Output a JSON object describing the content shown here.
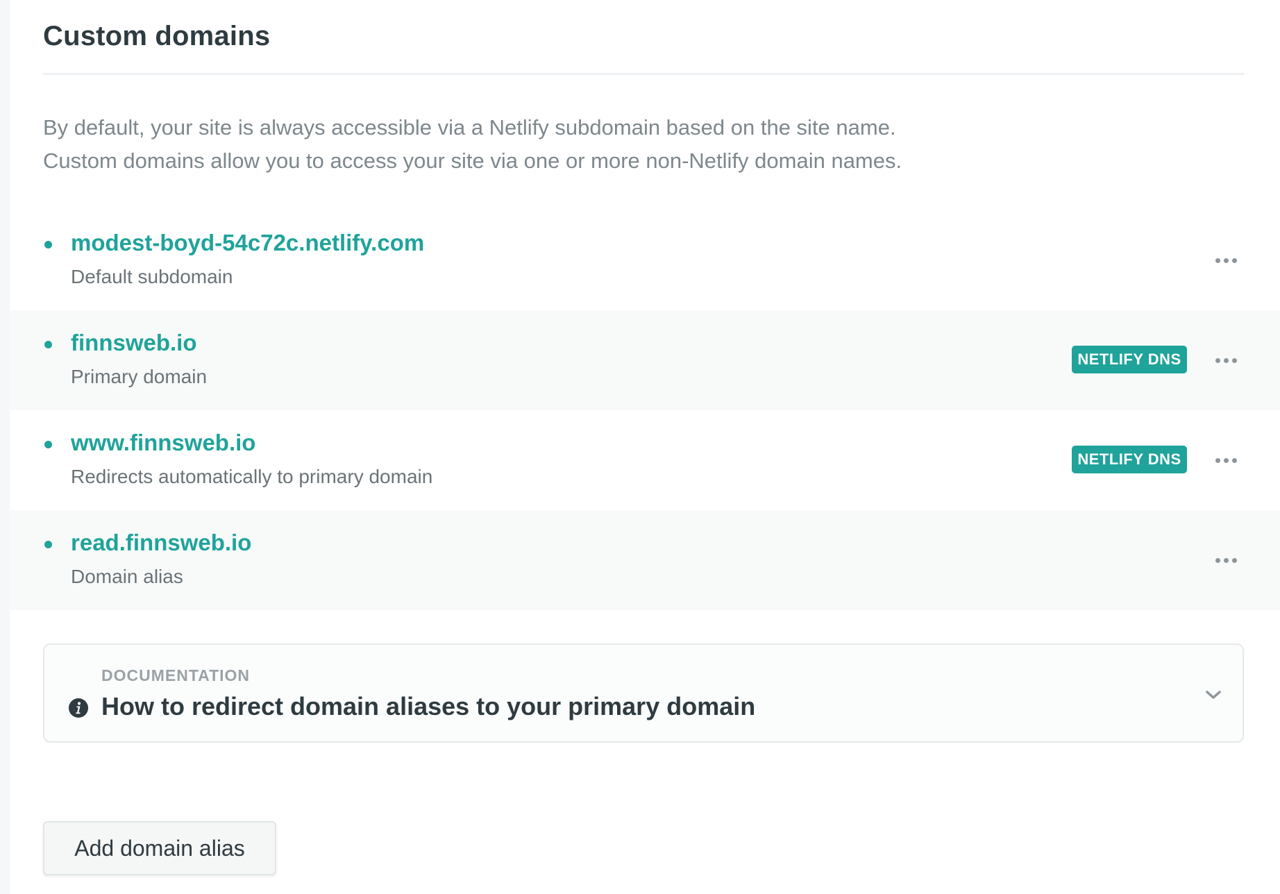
{
  "section": {
    "title": "Custom domains",
    "description": [
      "By default, your site is always accessible via a Netlify subdomain based on the site name.",
      "Custom domains allow you to access your site via one or more non-Netlify domain names."
    ]
  },
  "domains": [
    {
      "name": "modest-boyd-54c72c.netlify.com",
      "subtitle": "Default subdomain",
      "badge": ""
    },
    {
      "name": "finnsweb.io",
      "subtitle": "Primary domain",
      "badge": "NETLIFY DNS"
    },
    {
      "name": "www.finnsweb.io",
      "subtitle": "Redirects automatically to primary domain",
      "badge": "NETLIFY DNS"
    },
    {
      "name": "read.finnsweb.io",
      "subtitle": "Domain alias",
      "badge": ""
    }
  ],
  "documentation": {
    "kicker": "DOCUMENTATION",
    "title": "How to redirect domain aliases to your primary domain"
  },
  "actions": {
    "add_alias_label": "Add domain alias"
  },
  "colors": {
    "accent": "#1fa39a",
    "heading": "#2e3b40",
    "muted": "#7d878c"
  },
  "icons": {
    "more": "more-horizontal-icon",
    "info": "info-circle-icon",
    "chevron": "chevron-down-icon"
  }
}
